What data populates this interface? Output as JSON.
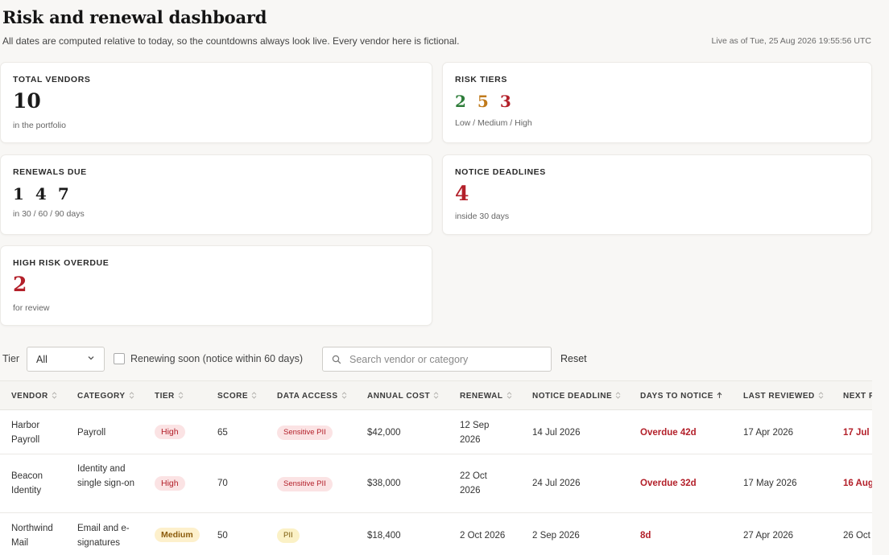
{
  "header": {
    "title": "Risk and renewal dashboard",
    "subtitle": "All dates are computed relative to today, so the countdowns always look live. Every vendor here is fictional.",
    "live_as_of": "Live as of Tue, 25 Aug 2026 19:55:56 UTC"
  },
  "cards": {
    "total_vendors": {
      "label": "TOTAL VENDORS",
      "value": "10",
      "sub": "in the portfolio"
    },
    "risk_tiers": {
      "label": "RISK TIERS",
      "low": "2",
      "medium": "5",
      "high": "3",
      "sub": "Low / Medium / High"
    },
    "renewals_due": {
      "label": "RENEWALS DUE",
      "d30": "1",
      "d60": "4",
      "d90": "7",
      "sub": "in 30 / 60 / 90 days"
    },
    "notice_deadlines": {
      "label": "NOTICE DEADLINES",
      "value": "4",
      "sub": "inside 30 days"
    },
    "high_risk_overdue": {
      "label": "HIGH RISK OVERDUE",
      "value": "2",
      "sub": "for review"
    }
  },
  "filters": {
    "tier_label": "Tier",
    "tier_value": "All",
    "renewing_soon_label": "Renewing soon (notice within 60 days)",
    "renewing_soon_checked": false,
    "search_placeholder": "Search vendor or category",
    "search_value": "",
    "reset_label": "Reset"
  },
  "table": {
    "columns": [
      "VENDOR",
      "CATEGORY",
      "TIER",
      "SCORE",
      "DATA ACCESS",
      "ANNUAL COST",
      "RENEWAL",
      "NOTICE DEADLINE",
      "DAYS TO NOTICE",
      "LAST REVIEWED",
      "NEXT R"
    ],
    "sorted_column": "DAYS TO NOTICE",
    "sort_direction": "ascending",
    "rows": [
      {
        "vendor": "Harbor Payroll",
        "category": "Payroll",
        "tier": "High",
        "score": "65",
        "data_access": "Sensitive PII",
        "annual_cost": "$42,000",
        "renewal": "12 Sep 2026",
        "notice_deadline": "14 Jul 2026",
        "days_to_notice": "Overdue 42d",
        "last_reviewed": "17 Apr 2026",
        "next_review": "17 Jul"
      },
      {
        "vendor": "Beacon Identity",
        "category": "Identity and single sign-on",
        "tier": "High",
        "score": "70",
        "data_access": "Sensitive PII",
        "annual_cost": "$38,000",
        "renewal": "22 Oct 2026",
        "notice_deadline": "24 Jul 2026",
        "days_to_notice": "Overdue 32d",
        "last_reviewed": "17 May 2026",
        "next_review": "16 Aug"
      },
      {
        "vendor": "Northwind Mail",
        "category": "Email and e-signatures",
        "tier": "Medium",
        "score": "50",
        "data_access": "PII",
        "annual_cost": "$18,400",
        "renewal": "2 Oct 2026",
        "notice_deadline": "2 Sep 2026",
        "days_to_notice": "8d",
        "last_reviewed": "27 Apr 2026",
        "next_review": "26 Oct"
      }
    ]
  },
  "colors": {
    "low": "#2e7d3a",
    "medium": "#c07a1c",
    "high": "#b3202a",
    "background": "#f8f7f5"
  }
}
